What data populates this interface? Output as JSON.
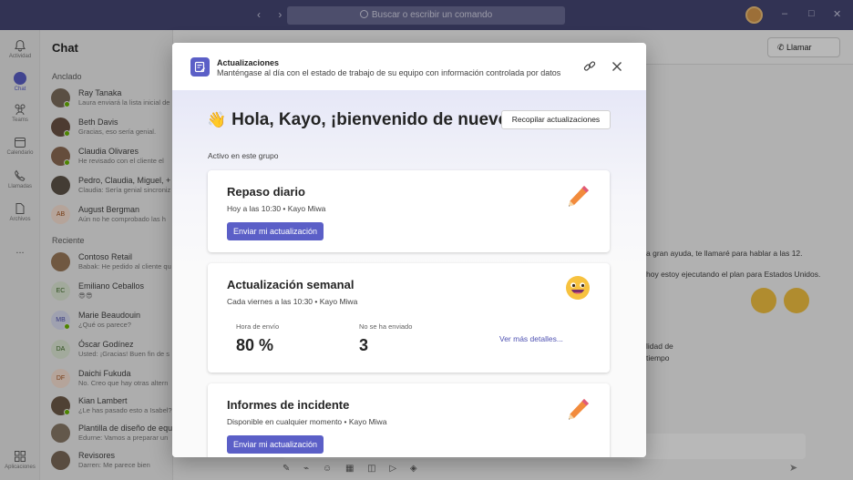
{
  "titlebar": {
    "search_placeholder": "Buscar o escribir un comando",
    "back": "‹",
    "forward": "›",
    "minimize": "–",
    "maximize": "□",
    "close": "✕"
  },
  "rail": [
    {
      "label": "Actividad",
      "icon": "bell-icon"
    },
    {
      "label": "Chat",
      "icon": "chat-icon"
    },
    {
      "label": "Teams",
      "icon": "teams-icon"
    },
    {
      "label": "Calendario",
      "icon": "calendar-icon"
    },
    {
      "label": "Llamadas",
      "icon": "phone-icon"
    },
    {
      "label": "Archivos",
      "icon": "file-icon"
    },
    {
      "label": "...",
      "icon": "more-icon"
    },
    {
      "label": "Aplicaciones",
      "icon": "apps-icon"
    }
  ],
  "chatlist": {
    "title": "Chat",
    "pinned_label": "Anclado",
    "recent_label": "Reciente",
    "pinned": [
      {
        "name": "Ray Tanaka",
        "preview": "Laura enviará la lista inicial de"
      },
      {
        "name": "Beth Davis",
        "preview": "Gracias, eso sería genial."
      },
      {
        "name": "Claudia Olivares",
        "preview": "He revisado con el cliente el"
      },
      {
        "name": "Pedro, Claudia, Miguel, +",
        "preview": "Claudia: Sería genial sincroniz"
      },
      {
        "name": "August Bergman",
        "initials": "AB",
        "preview": "Aún no he comprobado las h"
      }
    ],
    "recent": [
      {
        "name": "Contoso Retail",
        "preview": "Babak: He pedido al cliente qu"
      },
      {
        "name": "Emiliano Ceballos",
        "initials": "EC",
        "preview": "😎😎"
      },
      {
        "name": "Marie Beaudouin",
        "initials": "MB",
        "preview": "¿Qué os parece?"
      },
      {
        "name": "Óscar Godínez",
        "initials": "DA",
        "preview": "Usted: ¡Gracias! Buen fin de s"
      },
      {
        "name": "Daichi Fukuda",
        "initials": "DF",
        "preview": "No. Creo que hay otras altern"
      },
      {
        "name": "Kian Lambert",
        "preview": "¿Le has pasado esto a Isabel?"
      },
      {
        "name": "Plantilla de diseño de equ",
        "preview": "Edurne: Vamos a preparar un"
      },
      {
        "name": "Revisores",
        "preview": "Darren: Me parece bien"
      }
    ]
  },
  "conversation": {
    "call_label": "Llamar",
    "messages": [
      "a gran ayuda, te llamaré para hablar a las 12.",
      "hoy estoy ejecutando el plan para Estados Unidos.",
      "lidad de",
      "tiempo"
    ]
  },
  "dialog": {
    "title": "Actualizaciones",
    "subtitle": "Manténgase al día con el estado de trabajo de su equipo con información controlada por datos",
    "greeting": "Hola, Kayo, ¡bienvenido de nuevo!",
    "wave_emoji": "👋",
    "collect_button": "Recopilar actualizaciones",
    "active_label": "Activo en este grupo",
    "cards": [
      {
        "title": "Repaso diario",
        "meta": "Hoy a las 10:30 • Kayo Miwa",
        "button": "Enviar mi actualización",
        "icon": "pencil-icon"
      },
      {
        "title": "Actualización semanal",
        "meta": "Cada viernes a las 10:30 • Kayo Miwa",
        "icon": "smiley-icon",
        "stats": [
          {
            "label": "Hora de envío",
            "value": "80 %"
          },
          {
            "label": "No se ha enviado",
            "value": "3"
          }
        ],
        "more_link": "Ver más detalles..."
      },
      {
        "title": "Informes de incidente",
        "meta": "Disponible en cualquier momento • Kayo Miwa",
        "button": "Enviar mi actualización",
        "icon": "pencil-icon"
      }
    ]
  }
}
